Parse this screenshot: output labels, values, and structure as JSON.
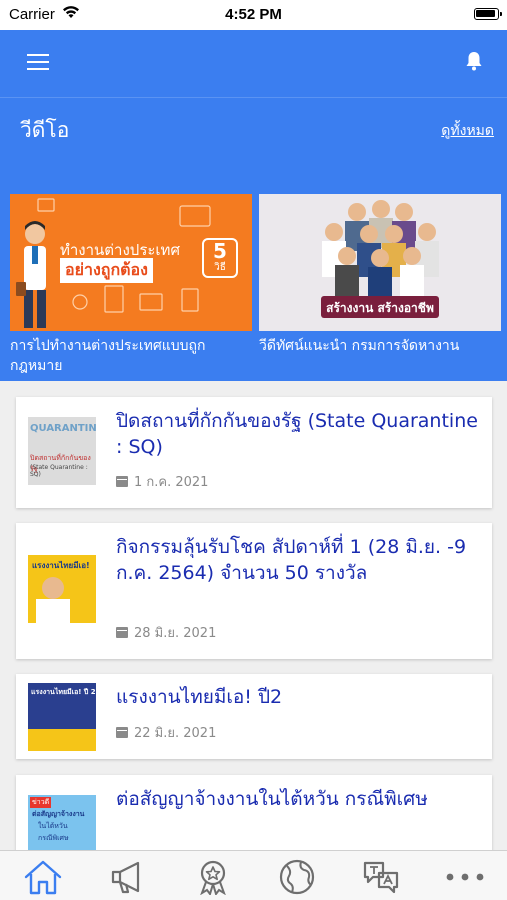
{
  "status_bar": {
    "carrier": "Carrier",
    "time": "4:52 PM"
  },
  "section": {
    "title": "วีดีโอ",
    "see_all": "ดูทั้งหมด"
  },
  "videos": [
    {
      "caption": "การไปทำงานต่างประเทศแบบถูกกฎหมาย",
      "thumb_line1": "ทำงานต่างประเทศ",
      "thumb_line2": "อย่างถูกต้อง",
      "thumb_number": "5",
      "thumb_unit": "วิธี"
    },
    {
      "caption": "วีดีทัศน์แนะนำ กรมการจัดหางาน",
      "thumb_banner": "สร้างงาน สร้างอาชีพ"
    }
  ],
  "news": [
    {
      "title": "ปิดสถานที่กักกันของรัฐ (State Quarantine : SQ)",
      "date": "1 ก.ค. 2021",
      "thumb_text": "QUARANTINE",
      "thumb_sub": "ปิดสถานที่กักกันของรัฐ",
      "thumb_sub2": "(State Quarantine : SQ)"
    },
    {
      "title": "กิจกรรมลุ้นรับโชค สัปดาห์ที่ 1 (28 มิ.ย. -9 ก.ค. 2564) จำนวน 50 รางวัล",
      "date": "28 มิ.ย. 2021",
      "thumb_text": "แรงงานไทยมีเอ!"
    },
    {
      "title": "แรงงานไทยมีเอ! ปี2",
      "date": "22 มิ.ย. 2021",
      "thumb_text": "แรงงานไทยมีเอ! ปี 2"
    },
    {
      "title": "ต่อสัญญาจ้างงานในไต้หวัน กรณีพิเศษ",
      "date": "",
      "thumb_tag": "ข่าวดี",
      "thumb_text": "ต่อสัญญาจ้างงาน",
      "thumb_sub": "ในไต้หวัน",
      "thumb_sub2": "กรณีพิเศษ"
    }
  ],
  "colors": {
    "primary": "#3b7ef0",
    "title_blue": "#1a2cb0",
    "tab_icon": "#3b7ef0",
    "tab_icon_inactive": "#6e6e6e"
  },
  "tabs": [
    {
      "icon": "home-icon",
      "active": true
    },
    {
      "icon": "megaphone-icon",
      "active": false
    },
    {
      "icon": "award-icon",
      "active": false
    },
    {
      "icon": "globe-icon",
      "active": false
    },
    {
      "icon": "translate-icon",
      "active": false
    },
    {
      "icon": "more-icon",
      "active": false
    }
  ]
}
